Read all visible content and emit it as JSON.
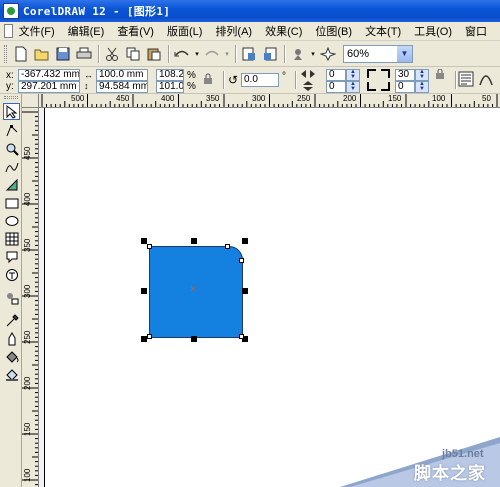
{
  "window": {
    "title": "CorelDRAW 12 - [图形1]"
  },
  "menu": {
    "items": [
      "文件(F)",
      "编辑(E)",
      "查看(V)",
      "版面(L)",
      "排列(A)",
      "效果(C)",
      "位图(B)",
      "文本(T)",
      "工具(O)",
      "窗口"
    ]
  },
  "toolbar": {
    "icons": [
      "new-icon",
      "open-icon",
      "save-icon",
      "print-icon",
      "cut-icon",
      "copy-icon",
      "paste-icon",
      "undo-icon",
      "redo-icon",
      "import-icon",
      "export-icon",
      "launcher-icon",
      "app-launcher-icon"
    ],
    "zoom": "60%"
  },
  "property_bar": {
    "x_label": "x:",
    "y_label": "y:",
    "x": "-367.432 mm",
    "y": "297.201 mm",
    "width": "100.0 mm",
    "height": "94.584 mm",
    "scale_x": "108.2",
    "scale_y": "101.0",
    "percent": "%",
    "rotation": "0.0",
    "degree": "°",
    "corner_tl": "0",
    "corner_bl": "0",
    "corner_tr": "30",
    "corner_br": "0"
  },
  "rulers": {
    "horizontal": [
      "500",
      "450",
      "400",
      "350",
      "300",
      "250",
      "200",
      "150",
      "100",
      "50"
    ],
    "vertical": [
      "450",
      "400",
      "350",
      "300",
      "250",
      "200",
      "150",
      "100"
    ]
  },
  "toolbox": {
    "tools": [
      "pick-tool-icon",
      "shape-tool-icon",
      "zoom-tool-icon",
      "freehand-tool-icon",
      "smart-fill-tool-icon",
      "rectangle-tool-icon",
      "ellipse-tool-icon",
      "polygon-tool-icon",
      "basic-shapes-tool-icon",
      "text-tool-icon",
      "interactive-blend-tool-icon",
      "eyedropper-tool-icon",
      "outline-tool-icon",
      "fill-tool-icon",
      "interactive-fill-tool-icon"
    ]
  },
  "canvas": {
    "shape_fill": "#1480e0"
  },
  "watermark": {
    "site": "jb51.net",
    "name": "脚本之家"
  }
}
